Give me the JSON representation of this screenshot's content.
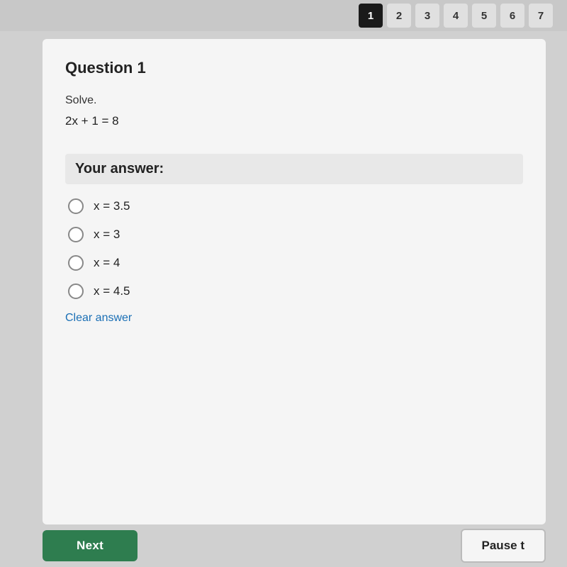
{
  "topNav": {
    "numbers": [
      {
        "label": "1",
        "active": true
      },
      {
        "label": "2",
        "active": false
      },
      {
        "label": "3",
        "active": false
      },
      {
        "label": "4",
        "active": false
      },
      {
        "label": "5",
        "active": false
      },
      {
        "label": "6",
        "active": false
      },
      {
        "label": "7",
        "active": false
      }
    ]
  },
  "question": {
    "title": "Question 1",
    "prompt": "Solve.",
    "equation": "2x + 1 = 8",
    "yourAnswerLabel": "Your answer:",
    "options": [
      {
        "id": "opt1",
        "text": "x = 3.5"
      },
      {
        "id": "opt2",
        "text": "x = 3"
      },
      {
        "id": "opt3",
        "text": "x = 4"
      },
      {
        "id": "opt4",
        "text": "x = 4.5"
      }
    ],
    "clearAnswerLabel": "Clear answer"
  },
  "buttons": {
    "nextLabel": "Next",
    "pauseLabel": "Pause t"
  }
}
